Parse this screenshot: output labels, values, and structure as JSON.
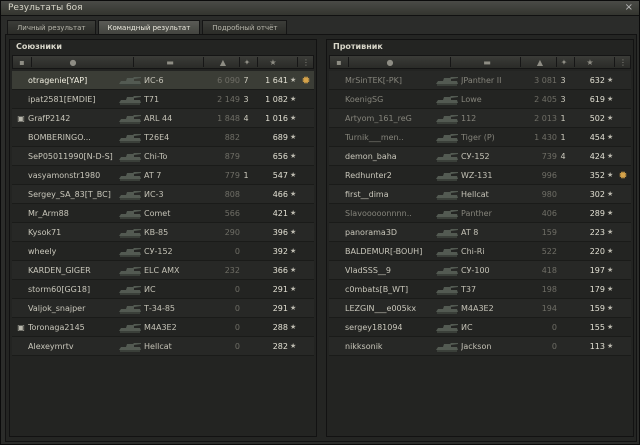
{
  "window": {
    "title": "Результаты боя",
    "close_glyph": "×"
  },
  "tabs": [
    {
      "label": "Личный результат",
      "active": false
    },
    {
      "label": "Командный результат",
      "active": true
    },
    {
      "label": "Подробный отчёт",
      "active": false
    }
  ],
  "left": {
    "title": "Союзники",
    "rows": [
      {
        "name": "otragenie[YAP]",
        "tank": "ИС-6",
        "damage": "6 090",
        "kills": "7",
        "xp": "1 641",
        "medal": true,
        "highlight": true,
        "dead": false,
        "chat": false
      },
      {
        "name": "ipat2581[EMDIE]",
        "tank": "T71",
        "damage": "2 149",
        "kills": "3",
        "xp": "1 082",
        "medal": false,
        "highlight": false,
        "dead": false,
        "chat": false
      },
      {
        "name": "GrafP2142",
        "tank": "ARL 44",
        "damage": "1 848",
        "kills": "4",
        "xp": "1 016",
        "medal": false,
        "highlight": false,
        "dead": false,
        "chat": true
      },
      {
        "name": "BOMBERINGO...",
        "tank": "T26E4",
        "damage": "882",
        "kills": "",
        "xp": "689",
        "medal": false,
        "highlight": false,
        "dead": false,
        "chat": false
      },
      {
        "name": "SeP05011990[N-D-S]",
        "tank": "Chi-To",
        "damage": "879",
        "kills": "",
        "xp": "656",
        "medal": false,
        "highlight": false,
        "dead": false,
        "chat": false
      },
      {
        "name": "vasyamonstr1980",
        "tank": "AT 7",
        "damage": "779",
        "kills": "1",
        "xp": "547",
        "medal": false,
        "highlight": false,
        "dead": false,
        "chat": false
      },
      {
        "name": "Sergey_SA_83[T_BC]",
        "tank": "ИС-3",
        "damage": "808",
        "kills": "",
        "xp": "466",
        "medal": false,
        "highlight": false,
        "dead": false,
        "chat": false
      },
      {
        "name": "Mr_Arm88",
        "tank": "Comet",
        "damage": "566",
        "kills": "",
        "xp": "421",
        "medal": false,
        "highlight": false,
        "dead": false,
        "chat": false
      },
      {
        "name": "Kysok71",
        "tank": "КВ-85",
        "damage": "290",
        "kills": "",
        "xp": "396",
        "medal": false,
        "highlight": false,
        "dead": false,
        "chat": false
      },
      {
        "name": "wheely",
        "tank": "СУ-152",
        "damage": "0",
        "kills": "",
        "xp": "392",
        "medal": false,
        "highlight": false,
        "dead": false,
        "chat": false
      },
      {
        "name": "KARDEN_GIGER",
        "tank": "ELC AMX",
        "damage": "232",
        "kills": "",
        "xp": "366",
        "medal": false,
        "highlight": false,
        "dead": false,
        "chat": false
      },
      {
        "name": "storm60[GG18]",
        "tank": "ИС",
        "damage": "0",
        "kills": "",
        "xp": "291",
        "medal": false,
        "highlight": false,
        "dead": false,
        "chat": false
      },
      {
        "name": "Valjok_snajper",
        "tank": "Т-34-85",
        "damage": "0",
        "kills": "",
        "xp": "291",
        "medal": false,
        "highlight": false,
        "dead": false,
        "chat": false
      },
      {
        "name": "Toronaga2145",
        "tank": "M4A3E2",
        "damage": "0",
        "kills": "",
        "xp": "288",
        "medal": false,
        "highlight": false,
        "dead": false,
        "chat": true
      },
      {
        "name": "Alexeymrtv",
        "tank": "Hellcat",
        "damage": "0",
        "kills": "",
        "xp": "282",
        "medal": false,
        "highlight": false,
        "dead": false,
        "chat": false
      }
    ]
  },
  "right": {
    "title": "Противник",
    "rows": [
      {
        "name": "MrSinTEK[-PK]",
        "tank": "JPanther II",
        "damage": "3 081",
        "kills": "3",
        "xp": "632",
        "medal": false,
        "dead": true
      },
      {
        "name": "KoenigSG",
        "tank": "Lowe",
        "damage": "2 405",
        "kills": "3",
        "xp": "619",
        "medal": false,
        "dead": true
      },
      {
        "name": "Artyom_161_reG",
        "tank": "112",
        "damage": "2 013",
        "kills": "1",
        "xp": "502",
        "medal": false,
        "dead": true
      },
      {
        "name": "Turnik___men..",
        "tank": "Tiger (P)",
        "damage": "1 430",
        "kills": "1",
        "xp": "454",
        "medal": false,
        "dead": true
      },
      {
        "name": "demon_baha",
        "tank": "СУ-152",
        "damage": "739",
        "kills": "4",
        "xp": "424",
        "medal": false,
        "dead": false
      },
      {
        "name": "Redhunter2",
        "tank": "WZ-131",
        "damage": "996",
        "kills": "",
        "xp": "352",
        "medal": true,
        "dead": false
      },
      {
        "name": "first__dima",
        "tank": "Hellcat",
        "damage": "980",
        "kills": "",
        "xp": "302",
        "medal": false,
        "dead": false
      },
      {
        "name": "Slavooooonnnn..",
        "tank": "Panther",
        "damage": "406",
        "kills": "",
        "xp": "289",
        "medal": false,
        "dead": true
      },
      {
        "name": "panorama3D",
        "tank": "AT 8",
        "damage": "159",
        "kills": "",
        "xp": "223",
        "medal": false,
        "dead": false
      },
      {
        "name": "BALDEMUR[-BOUH]",
        "tank": "Chi-Ri",
        "damage": "522",
        "kills": "",
        "xp": "220",
        "medal": false,
        "dead": false
      },
      {
        "name": "VladSSS__9",
        "tank": "СУ-100",
        "damage": "418",
        "kills": "",
        "xp": "197",
        "medal": false,
        "dead": false
      },
      {
        "name": "c0mbats[B_WT]",
        "tank": "T37",
        "damage": "198",
        "kills": "",
        "xp": "179",
        "medal": false,
        "dead": false
      },
      {
        "name": "LEZGIN___e005kx",
        "tank": "M4A3E2",
        "damage": "194",
        "kills": "",
        "xp": "159",
        "medal": false,
        "dead": false
      },
      {
        "name": "sergey181094",
        "tank": "ИС",
        "damage": "0",
        "kills": "",
        "xp": "155",
        "medal": false,
        "dead": false
      },
      {
        "name": "nikksonik",
        "tank": "Jackson",
        "damage": "0",
        "kills": "",
        "xp": "113",
        "medal": false,
        "dead": false
      }
    ]
  },
  "icons": {
    "star": "★",
    "medal": "✹",
    "chat": "▣",
    "header": [
      "chat-icon",
      "player-icon",
      "tank-icon",
      "damage-icon",
      "kills-icon",
      "star-icon",
      "more-icon"
    ]
  },
  "colors": {
    "highlight_row": "#3b3d36",
    "xp_text": "#e2e0d3",
    "medal": "#d7a44a"
  }
}
